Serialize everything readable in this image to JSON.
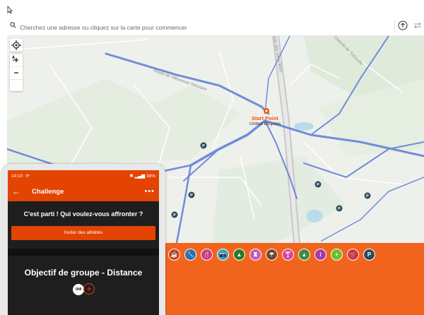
{
  "search": {
    "placeholder": "Cherchez une adresse ou cliquez sur la carte pour commencer"
  },
  "map": {
    "start_label": "Start Point",
    "start_sub": "United Bicycles",
    "road_labels": [
      "Route de Villeneuve-Tolosane",
      "Chemin des Deux Mers",
      "Chemin de Gabardie"
    ],
    "zoom_in": "+",
    "zoom_out": "−"
  },
  "poi_icons": [
    {
      "name": "coffee-icon",
      "color": "#c8401a",
      "glyph": "☕"
    },
    {
      "name": "wrench-icon",
      "color": "#2b6cb0",
      "glyph": "🔧"
    },
    {
      "name": "food-icon",
      "color": "#d2387f",
      "glyph": "🍴"
    },
    {
      "name": "camera-icon",
      "color": "#2ba5c8",
      "glyph": "📷"
    },
    {
      "name": "tree-icon",
      "color": "#2a7a2a",
      "glyph": "▲"
    },
    {
      "name": "monument-icon",
      "color": "#c05abf",
      "glyph": "♜"
    },
    {
      "name": "umbrella-icon",
      "color": "#6e4a2a",
      "glyph": "☂"
    },
    {
      "name": "bar-icon",
      "color": "#e040a0",
      "glyph": "🍸"
    },
    {
      "name": "mountain-icon",
      "color": "#3c8a3c",
      "glyph": "▲"
    },
    {
      "name": "info-icon",
      "color": "#a63aa6",
      "glyph": "i"
    },
    {
      "name": "plus-icon",
      "color": "#6dbf2a",
      "glyph": "+"
    },
    {
      "name": "cart-icon",
      "color": "#d6303a",
      "glyph": "🛒"
    },
    {
      "name": "parking-icon",
      "color": "#2e4a5a",
      "glyph": "P"
    }
  ],
  "phone": {
    "time": "14:10",
    "status_right": "38%",
    "title": "Challenge",
    "prompt": "C'est parti ! Qui voulez-vous affronter ?",
    "invite_label": "Inviter des athlètes",
    "goal": "Objectif de groupe - Distance",
    "avatar_text": "UNI"
  },
  "colors": {
    "strava_orange": "#fc5200",
    "app_orange": "#e34402",
    "route_blue": "#5b7bd5"
  }
}
